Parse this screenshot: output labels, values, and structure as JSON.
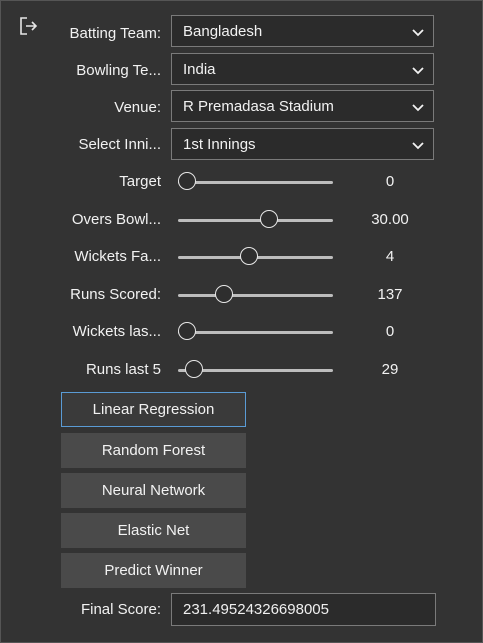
{
  "icons": {
    "exit": "exit-icon",
    "chevron": "chevron-down-icon"
  },
  "form": {
    "batting_team": {
      "label": "Batting Team:",
      "value": "Bangladesh"
    },
    "bowling_team": {
      "label": "Bowling Te...",
      "value": "India"
    },
    "venue": {
      "label": "Venue:",
      "value": "R Premadasa Stadium"
    },
    "innings": {
      "label": "Select Inni...",
      "value": "1st Innings"
    }
  },
  "sliders": {
    "target": {
      "label": "Target",
      "value": "0",
      "level": 0.0
    },
    "overs": {
      "label": "Overs Bowl...",
      "value": "30.00",
      "level": 0.6
    },
    "wickets": {
      "label": "Wickets Fa...",
      "value": "4",
      "level": 0.45
    },
    "runs": {
      "label": "Runs Scored:",
      "value": "137",
      "level": 0.27
    },
    "wickets_last5": {
      "label": "Wickets las...",
      "value": "0",
      "level": 0.0
    },
    "runs_last5": {
      "label": "Runs last 5",
      "value": "29",
      "level": 0.05
    }
  },
  "buttons": {
    "linear_regression": "Linear Regression",
    "random_forest": "Random Forest",
    "neural_network": "Neural Network",
    "elastic_net": "Elastic Net",
    "predict_winner": "Predict Winner"
  },
  "result": {
    "label": "Final Score:",
    "value": "231.49524326698005"
  },
  "colors": {
    "background": "#333333",
    "focus": "#5a9bd5",
    "button": "#4a4a4a"
  }
}
